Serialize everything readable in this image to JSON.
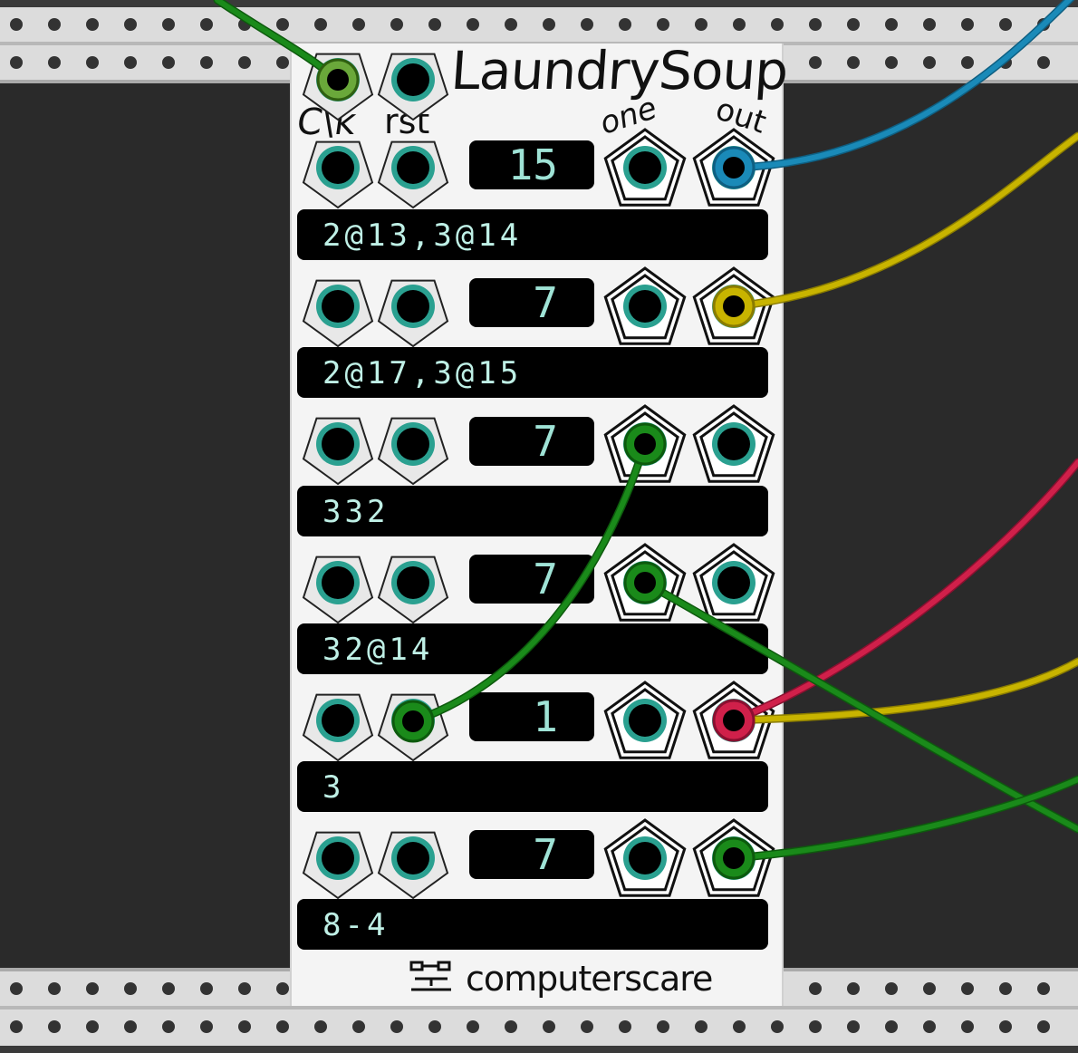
{
  "module": {
    "title": "LaundrySoup",
    "brand": "computerscare",
    "labels": {
      "clock": "C\\k",
      "reset": "rst",
      "one": "one",
      "out": "out"
    }
  },
  "rows": [
    {
      "step_display": "15",
      "sequence": "2@13,3@14"
    },
    {
      "step_display": "7",
      "sequence": "2@17,3@15"
    },
    {
      "step_display": "7",
      "sequence": "332"
    },
    {
      "step_display": "7",
      "sequence": "32@14"
    },
    {
      "step_display": "1",
      "sequence": "3"
    },
    {
      "step_display": "7",
      "sequence": "8-4"
    }
  ],
  "colors": {
    "panel": "#f4f4f4",
    "rack_dark": "#2a2a2a",
    "rail": "#d8d8d8",
    "display_text": "#9fe3d6",
    "jack_ring": "#2aa090",
    "cable_green": "#1a8a1a",
    "cable_blue": "#1a8ab8",
    "cable_yellow": "#c8b400",
    "cable_red": "#d0204a"
  }
}
